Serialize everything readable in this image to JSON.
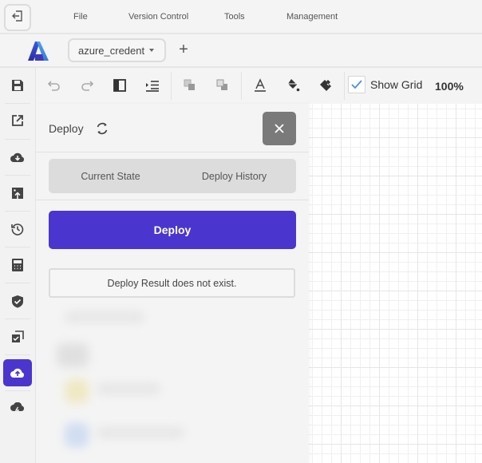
{
  "menubar": {
    "exit_icon": "exit-icon",
    "items": [
      "File",
      "Version Control",
      "Tools",
      "Management"
    ]
  },
  "projectbar": {
    "logo": "azure-logo",
    "project_name": "azure_credent",
    "add_label": "+"
  },
  "toolbar": {
    "icons": [
      "save-icon",
      "undo-icon",
      "redo-icon",
      "panel-toggle-icon",
      "indent-icon",
      "bring-front-icon",
      "send-back-icon",
      "text-color-icon",
      "fill-color-icon",
      "format-paint-icon"
    ],
    "show_grid_label": "Show Grid",
    "show_grid_checked": true,
    "zoom_level": "100%"
  },
  "sidebar": {
    "items": [
      {
        "icon": "export-icon",
        "active": false
      },
      {
        "icon": "cloud-download-icon",
        "active": false
      },
      {
        "icon": "image-upload-icon",
        "active": false
      },
      {
        "icon": "history-icon",
        "active": false
      },
      {
        "icon": "calculator-icon",
        "active": false
      },
      {
        "icon": "shield-check-icon",
        "active": false
      },
      {
        "icon": "copy-check-icon",
        "active": false
      },
      {
        "icon": "cloud-upload-icon",
        "active": true
      },
      {
        "icon": "cloud-lightning-icon",
        "active": false
      }
    ]
  },
  "panel": {
    "title": "Deploy",
    "tabs": [
      "Current State",
      "Deploy History"
    ],
    "deploy_button": "Deploy",
    "result_message": "Deploy Result does not exist."
  },
  "colors": {
    "accent": "#4b35cf",
    "close_button": "#7a7a7a",
    "checkbox_check": "#4a90e2"
  }
}
